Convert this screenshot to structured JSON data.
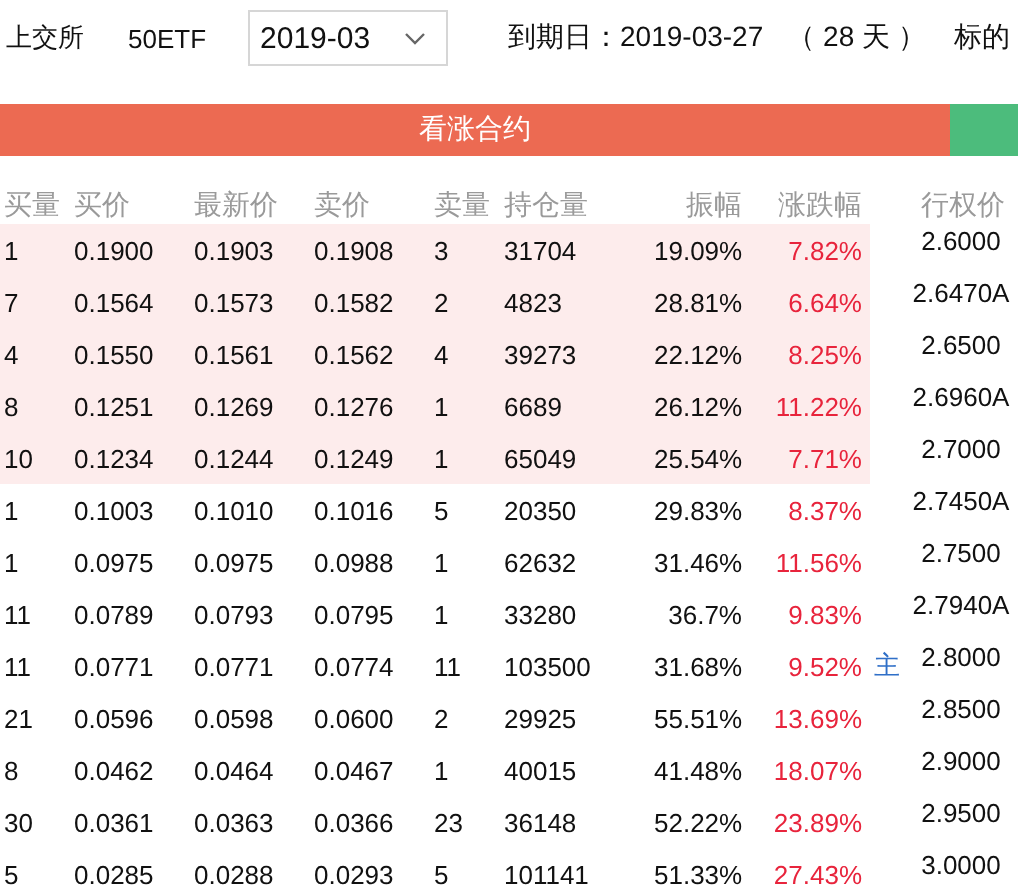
{
  "header": {
    "exchange": "上交所",
    "underlying": "50ETF",
    "month_select": {
      "value": "2019-03"
    },
    "expiry": "到期日：2019-03-27",
    "days_left": "（ 28 天 ）",
    "underlying_label": "标的"
  },
  "sections": [
    {
      "kind": "call",
      "label": "看涨合约"
    },
    {
      "kind": "put"
    }
  ],
  "columns": [
    "买量",
    "买价",
    "最新价",
    "卖价",
    "卖量",
    "持仓量",
    "振幅",
    "涨跌幅",
    "行权价"
  ],
  "rows": [
    {
      "cells": [
        "1",
        "0.1900",
        "0.1903",
        "0.1908",
        "3",
        "31704",
        "19.09%",
        "7.82%"
      ],
      "strike": "2.6000",
      "in_the_money": true
    },
    {
      "cells": [
        "7",
        "0.1564",
        "0.1573",
        "0.1582",
        "2",
        "4823",
        "28.81%",
        "6.64%"
      ],
      "strike": "2.6470A",
      "in_the_money": true
    },
    {
      "cells": [
        "4",
        "0.1550",
        "0.1561",
        "0.1562",
        "4",
        "39273",
        "22.12%",
        "8.25%"
      ],
      "strike": "2.6500",
      "in_the_money": true
    },
    {
      "cells": [
        "8",
        "0.1251",
        "0.1269",
        "0.1276",
        "1",
        "6689",
        "26.12%",
        "11.22%"
      ],
      "strike": "2.6960A",
      "in_the_money": true
    },
    {
      "cells": [
        "10",
        "0.1234",
        "0.1244",
        "0.1249",
        "1",
        "65049",
        "25.54%",
        "7.71%"
      ],
      "strike": "2.7000",
      "in_the_money": true
    },
    {
      "cells": [
        "1",
        "0.1003",
        "0.1010",
        "0.1016",
        "5",
        "20350",
        "29.83%",
        "8.37%"
      ],
      "strike": "2.7450A",
      "in_the_money": false
    },
    {
      "cells": [
        "1",
        "0.0975",
        "0.0975",
        "0.0988",
        "1",
        "62632",
        "31.46%",
        "11.56%"
      ],
      "strike": "2.7500",
      "in_the_money": false
    },
    {
      "cells": [
        "11",
        "0.0789",
        "0.0793",
        "0.0795",
        "1",
        "33280",
        "36.7%",
        "9.83%"
      ],
      "strike": "2.7940A",
      "in_the_money": false
    },
    {
      "cells": [
        "11",
        "0.0771",
        "0.0771",
        "0.0774",
        "11",
        "103500",
        "31.68%",
        "9.52%"
      ],
      "marker": "主",
      "strike": "2.8000",
      "in_the_money": false
    },
    {
      "cells": [
        "21",
        "0.0596",
        "0.0598",
        "0.0600",
        "2",
        "29925",
        "55.51%",
        "13.69%"
      ],
      "strike": "2.8500",
      "in_the_money": false
    },
    {
      "cells": [
        "8",
        "0.0462",
        "0.0464",
        "0.0467",
        "1",
        "40015",
        "41.48%",
        "18.07%"
      ],
      "strike": "2.9000",
      "in_the_money": false
    },
    {
      "cells": [
        "30",
        "0.0361",
        "0.0363",
        "0.0366",
        "23",
        "36148",
        "52.22%",
        "23.89%"
      ],
      "strike": "2.9500",
      "in_the_money": false
    },
    {
      "cells": [
        "5",
        "0.0285",
        "0.0288",
        "0.0293",
        "5",
        "101141",
        "51.33%",
        "27.43%"
      ],
      "strike": "3.0000",
      "in_the_money": false
    }
  ]
}
